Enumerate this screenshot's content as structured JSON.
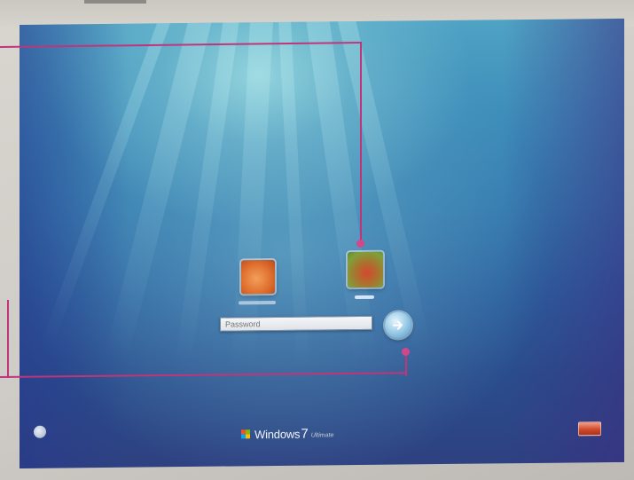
{
  "login_screen": {
    "password_placeholder": "Password",
    "os_name": "Windows",
    "os_version": "7",
    "os_edition": "Ultimate"
  },
  "icons": {
    "submit": "arrow-right-icon",
    "ease_of_access": "ease-of-access-icon",
    "power": "power-icon",
    "logo": "windows-flag-icon"
  },
  "colors": {
    "callout": "#c0357a",
    "background_top": "#4fa3c4",
    "background_bottom": "#2e4181",
    "user_tile_1": "#e0702f",
    "user_tile_2": "#7ea03c",
    "shutdown": "#d24a2c"
  }
}
